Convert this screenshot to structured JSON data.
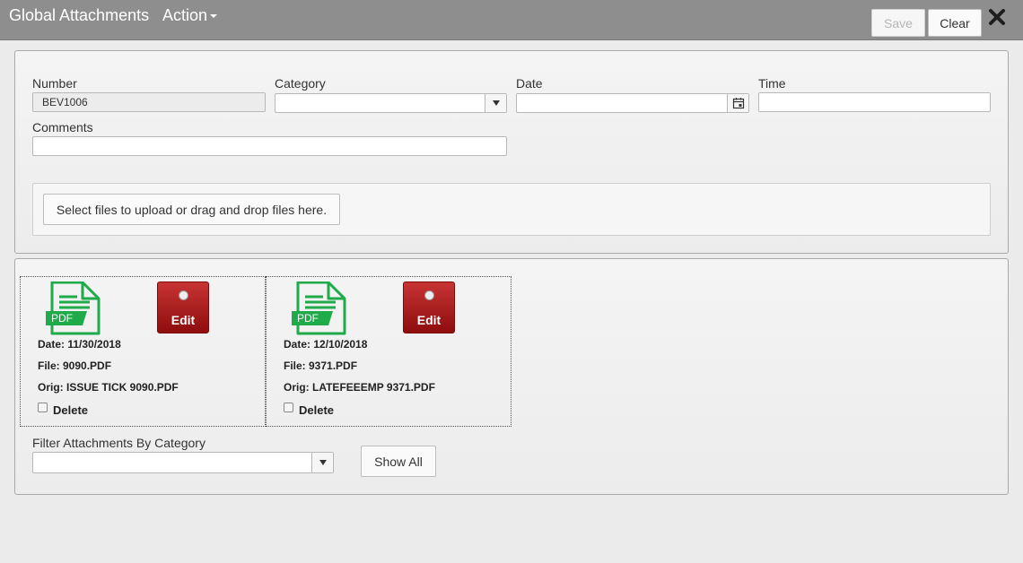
{
  "header": {
    "title": "Global Attachments",
    "action_label": "Action",
    "save_label": "Save",
    "clear_label": "Clear",
    "close_icon": "close-icon"
  },
  "form": {
    "number_label": "Number",
    "number_value": "BEV1006",
    "category_label": "Category",
    "category_value": "",
    "date_label": "Date",
    "date_value": "",
    "time_label": "Time",
    "time_value": "",
    "comments_label": "Comments",
    "comments_value": "",
    "upload_label": "Select files to upload or drag and drop files here."
  },
  "attachments": [
    {
      "icon_text": "PDF",
      "edit_label": "Edit",
      "date_line": "Date: 11/30/2018",
      "file_line": "File: 9090.PDF",
      "orig_line": "Orig: ISSUE TICK 9090.PDF",
      "delete_label": "Delete"
    },
    {
      "icon_text": "PDF",
      "edit_label": "Edit",
      "date_line": "Date: 12/10/2018",
      "file_line": "File: 9371.PDF",
      "orig_line": "Orig: LATEFEEEMP 9371.PDF",
      "delete_label": "Delete"
    }
  ],
  "filter": {
    "label": "Filter Attachments By Category",
    "value": "",
    "show_all_label": "Show All"
  },
  "colors": {
    "header_bg": "#8e8e8e",
    "pdf_green": "#1fab4a",
    "edit_red": "#a51c1c"
  }
}
